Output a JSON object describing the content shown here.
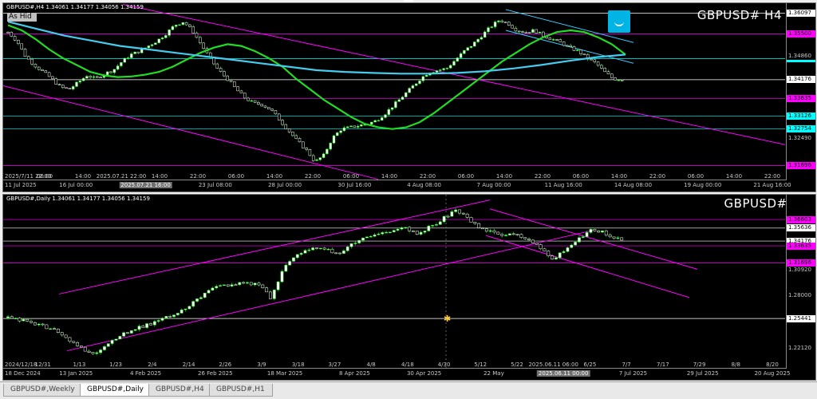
{
  "chart_data": [
    {
      "type": "candlestick",
      "symbol": "GBPUSD#",
      "timeframe": "H4",
      "title": "GBPUSD# H4",
      "info_text": "GBPUSD#,H4  1.34061 1.34177 1.34056 1.34159",
      "ohlc_last": {
        "open": 1.34061,
        "high": 1.34177,
        "low": 1.34056,
        "close": 1.34159
      },
      "ylim": [
        1.315,
        1.362
      ],
      "price_ticks": [
        "1.36097",
        "1.35500",
        "1.34860",
        "1.34783",
        "1.34176",
        "1.33635",
        "1.33126",
        "1.32754",
        "1.32490",
        "1.31696"
      ],
      "levels": [
        {
          "price": 1.36097,
          "label": "1.36097",
          "color": "#ffffff"
        },
        {
          "price": 1.355,
          "label": "1.35500",
          "color": "#ff00ff"
        },
        {
          "price": 1.34783,
          "label": "1.34783",
          "color": "#00ffff"
        },
        {
          "price": 1.34176,
          "label": "1.34176",
          "color": "#ffffff"
        },
        {
          "price": 1.33635,
          "label": "1.33635",
          "color": "#ff00ff"
        },
        {
          "price": 1.33126,
          "label": "1.33126",
          "color": "#00ffff"
        },
        {
          "price": 1.32754,
          "label": "1.32754",
          "color": "#00ffff"
        },
        {
          "price": 1.31696,
          "label": "1.31696",
          "color": "#ff00ff"
        }
      ],
      "time_labels": [
        "2025/7/11 22:00",
        "06:00",
        "14:00",
        "2025.07.21 22:00",
        "14:00",
        "22:00",
        "06:00",
        "14:00",
        "22:00",
        "06:00",
        "14:00",
        "22:00",
        "06:00",
        "14:00",
        "22:00",
        "06:00",
        "14:00",
        "22:00",
        "06:00",
        "14:00",
        "22:00"
      ],
      "time_labels_row2": [
        "11 Jul 2025",
        "16 Jul 00:00",
        "2025.07.21 16:00",
        "23 Jul 08:00",
        "28 Jul 00:00",
        "30 Jul 16:00",
        "4 Aug 08:00",
        "7 Aug 00:00",
        "11 Aug 16:00",
        "14 Aug 08:00",
        "19 Aug 00:00",
        "21 Aug 16:00"
      ],
      "close_path": [
        1.3555,
        1.353,
        1.3485,
        1.346,
        1.344,
        1.342,
        1.3395,
        1.339,
        1.341,
        1.343,
        1.342,
        1.3435,
        1.3445,
        1.347,
        1.349,
        1.35,
        1.3515,
        1.353,
        1.355,
        1.3575,
        1.3585,
        1.356,
        1.352,
        1.348,
        1.3445,
        1.342,
        1.339,
        1.3365,
        1.335,
        1.3345,
        1.333,
        1.33,
        1.327,
        1.324,
        1.3215,
        1.318,
        1.32,
        1.325,
        1.3275,
        1.328,
        1.3285,
        1.329,
        1.33,
        1.332,
        1.3345,
        1.337,
        1.3395,
        1.342,
        1.344,
        1.3445,
        1.345,
        1.3475,
        1.35,
        1.352,
        1.3545,
        1.357,
        1.359,
        1.358,
        1.356,
        1.3555,
        1.356,
        1.3545,
        1.3535,
        1.3525,
        1.351,
        1.35,
        1.348,
        1.3465,
        1.344,
        1.342,
        1.3418
      ],
      "moving_averages": [
        {
          "name": "MA fast",
          "color": "#22dd22",
          "values": [
            1.3575,
            1.356,
            1.3535,
            1.3505,
            1.348,
            1.346,
            1.344,
            1.343,
            1.3425,
            1.3427,
            1.3432,
            1.344,
            1.3455,
            1.3475,
            1.3495,
            1.351,
            1.352,
            1.3515,
            1.35,
            1.348,
            1.3455,
            1.342,
            1.339,
            1.336,
            1.3335,
            1.331,
            1.329,
            1.328,
            1.3275,
            1.328,
            1.3295,
            1.332,
            1.335,
            1.338,
            1.341,
            1.344,
            1.347,
            1.3495,
            1.352,
            1.354,
            1.3555,
            1.356,
            1.3555,
            1.354,
            1.352,
            1.349
          ]
        },
        {
          "name": "MA slow",
          "color": "#44ccee",
          "values": [
            1.3585,
            1.3565,
            1.3545,
            1.353,
            1.3515,
            1.3505,
            1.3495,
            1.3485,
            1.3475,
            1.3465,
            1.3455,
            1.3445,
            1.344,
            1.3437,
            1.3435,
            1.3435,
            1.3437,
            1.3442,
            1.345,
            1.346,
            1.3472,
            1.3483,
            1.349
          ]
        }
      ]
    },
    {
      "type": "candlestick",
      "symbol": "GBPUSD#",
      "timeframe": "Daily",
      "title": "GBPUSD# D1",
      "info_text": "GBPUSD#,Daily  1.34061 1.34177 1.34056 1.34159",
      "ohlc_last": {
        "open": 1.34061,
        "high": 1.34177,
        "low": 1.34056,
        "close": 1.34159
      },
      "ylim": [
        1.205,
        1.385
      ],
      "price_ticks": [
        "1.36603",
        "1.35636",
        "1.34176",
        "1.33635",
        "1.31696",
        "1.30920",
        "1.28000",
        "1.25441",
        "1.22120"
      ],
      "levels": [
        {
          "price": 1.36603,
          "label": "1.36603",
          "color": "#ff00ff"
        },
        {
          "price": 1.35636,
          "label": "1.35636",
          "color": "#ffffff"
        },
        {
          "price": 1.34176,
          "label": "1.34176",
          "color": "#ffffff"
        },
        {
          "price": 1.33635,
          "label": "1.33635",
          "color": "#ff00ff"
        },
        {
          "price": 1.31696,
          "label": "1.31696",
          "color": "#ff00ff"
        },
        {
          "price": 1.25441,
          "label": "1.25441",
          "color": "#ffffff"
        }
      ],
      "time_labels": [
        "2024/12/18",
        "12/31",
        "1/13",
        "1/23",
        "2/4",
        "2/14",
        "2/26",
        "3/9",
        "3/18",
        "3/27",
        "4/8",
        "4/18",
        "4/30",
        "5/12",
        "5/22",
        "2025.06.11 06:00",
        "6/25",
        "7/7",
        "7/17",
        "7/29",
        "8/8",
        "8/20"
      ],
      "time_labels_row2": [
        "18 Dec 2024",
        "13 Jan 2025",
        "4 Feb 2025",
        "26 Feb 2025",
        "18 Mar 2025",
        "8 Apr 2025",
        "30 Apr 2025",
        "22 May",
        "2025.06.11 00:00",
        "7 Jul 2025",
        "29 Jul 2025",
        "20 Aug 2025"
      ],
      "close_path": [
        1.255,
        1.253,
        1.251,
        1.248,
        1.244,
        1.24,
        1.232,
        1.225,
        1.218,
        1.215,
        1.222,
        1.232,
        1.238,
        1.243,
        1.246,
        1.25,
        1.255,
        1.26,
        1.264,
        1.272,
        1.28,
        1.288,
        1.292,
        1.293,
        1.295,
        1.294,
        1.292,
        1.275,
        1.305,
        1.32,
        1.328,
        1.332,
        1.334,
        1.331,
        1.328,
        1.336,
        1.342,
        1.346,
        1.349,
        1.352,
        1.355,
        1.356,
        1.35,
        1.356,
        1.362,
        1.37,
        1.376,
        1.37,
        1.36,
        1.354,
        1.35,
        1.348,
        1.35,
        1.345,
        1.34,
        1.33,
        1.32,
        1.331,
        1.339,
        1.348,
        1.355,
        1.352,
        1.347,
        1.3418
      ]
    }
  ],
  "h4": {
    "info_text": "GBPUSD#,H4  1.34061 1.34177 1.34056 1.34159",
    "title": "GBPUSD# H4",
    "hidden_tag": "As Hid"
  },
  "d1": {
    "info_text": "GBPUSD#,Daily  1.34061 1.34177 1.34056 1.34159",
    "title": "GBPUSD# D1"
  },
  "tabs": [
    {
      "label": "GBPUSD#,Weekly",
      "active": false
    },
    {
      "label": "GBPUSD#,Daily",
      "active": true
    },
    {
      "label": "GBPUSD#,H4",
      "active": false
    },
    {
      "label": "GBPUSD#,H1",
      "active": false
    }
  ],
  "colors": {
    "background": "#000000",
    "bull": "#ffffff",
    "bear": "#ffffff",
    "channel": "#ff00ff",
    "ma_fast": "#22dd22",
    "ma_slow": "#44ccee",
    "blue_channel": "#33ccff"
  }
}
